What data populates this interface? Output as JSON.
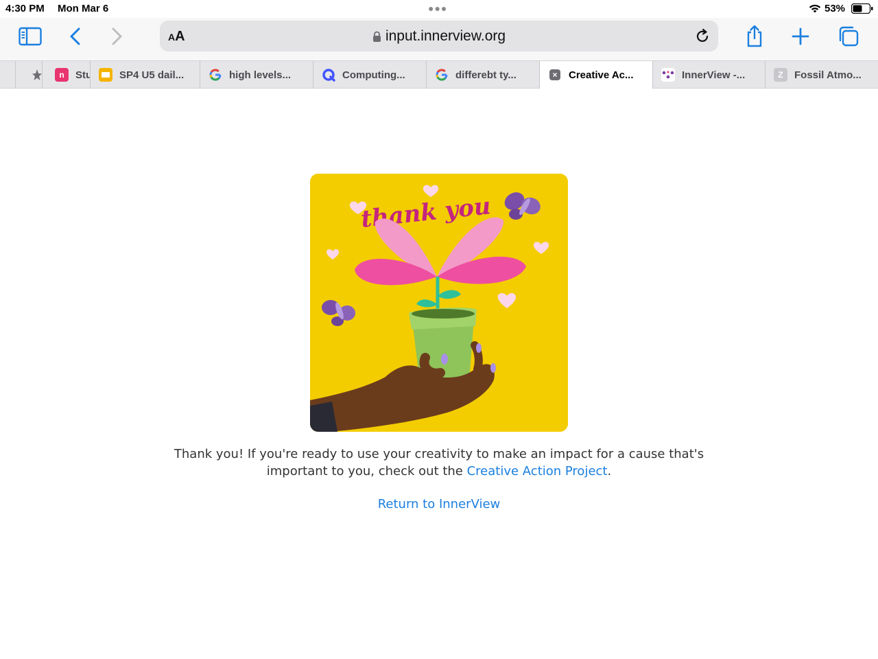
{
  "status": {
    "time": "4:30 PM",
    "date": "Mon Mar 6",
    "battery": "53%"
  },
  "toolbar": {
    "aa_small": "A",
    "aa_large": "A",
    "url": "input.innerview.org"
  },
  "tabs": [
    {
      "title": "Stu",
      "icon": "pinned-star-icon"
    },
    {
      "title": "SP4 U5 dail...",
      "icon": "google-slides-icon"
    },
    {
      "title": "high levels...",
      "icon": "google-icon"
    },
    {
      "title": "Computing...",
      "icon": "quizlet-icon"
    },
    {
      "title": "differebt ty...",
      "icon": "google-icon"
    },
    {
      "title": "Creative Ac...",
      "icon": "close-favicon-icon",
      "active": true
    },
    {
      "title": "InnerView -...",
      "icon": "innerview-icon"
    },
    {
      "title": "Fossil Atmo...",
      "icon": "z-icon"
    }
  ],
  "illustration": {
    "lettering": "thank you"
  },
  "message": {
    "text_before": "Thank you! If you're ready to use your creativity to make an impact for a cause that's important to you, check out the ",
    "link_text": "Creative Action Project",
    "text_after": "."
  },
  "return_link": "Return to InnerView",
  "colors": {
    "accent": "#1a7fe0",
    "card_bg": "#f3cd00"
  }
}
